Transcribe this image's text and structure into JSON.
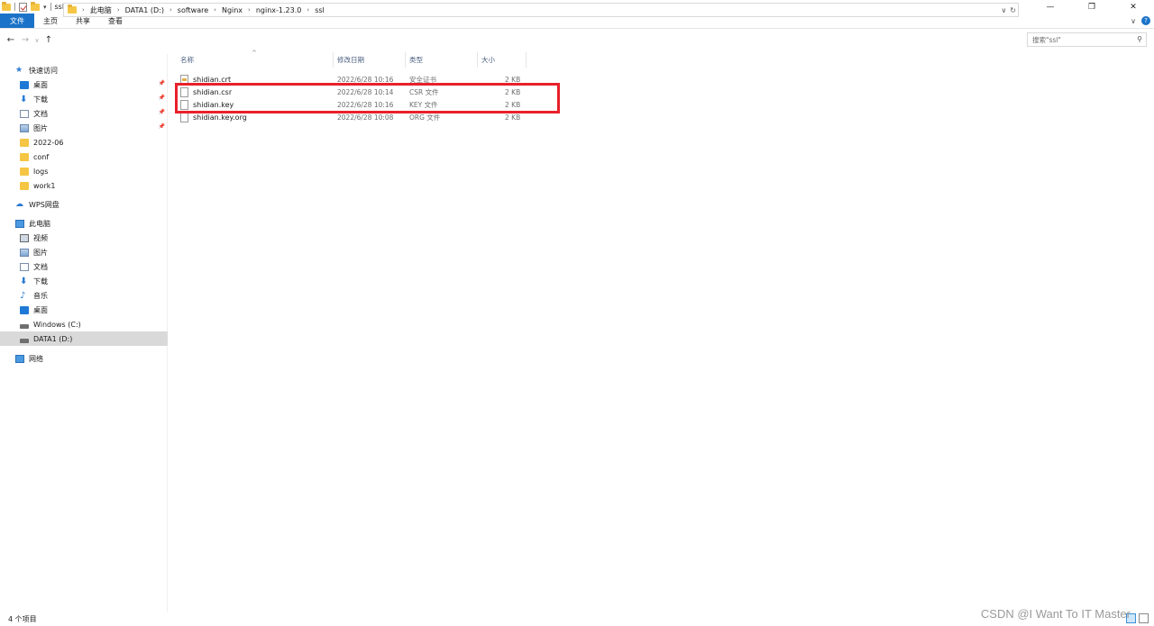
{
  "window": {
    "title": "ssl",
    "controls": [
      "—",
      "❐",
      "✕"
    ]
  },
  "ribbon": {
    "tabs": [
      "文件",
      "主页",
      "共享",
      "查看"
    ]
  },
  "address": {
    "crumbs": [
      "此电脑",
      "DATA1 (D:)",
      "software",
      "Nginx",
      "nginx-1.23.0",
      "ssl"
    ]
  },
  "search": {
    "placeholder": "搜索\"ssl\""
  },
  "sidebar": {
    "items": [
      {
        "label": "快速访问",
        "icon": "star-icon",
        "level": 0,
        "pinned": false,
        "selected": false
      },
      {
        "label": "桌面",
        "icon": "desktop-icon",
        "level": 1,
        "pinned": true,
        "selected": false
      },
      {
        "label": "下载",
        "icon": "download-icon",
        "level": 1,
        "pinned": true,
        "selected": false
      },
      {
        "label": "文档",
        "icon": "document-icon",
        "level": 1,
        "pinned": true,
        "selected": false
      },
      {
        "label": "图片",
        "icon": "picture-icon",
        "level": 1,
        "pinned": true,
        "selected": false
      },
      {
        "label": "2022-06",
        "icon": "folder-icon",
        "level": 1,
        "pinned": false,
        "selected": false
      },
      {
        "label": "conf",
        "icon": "folder-icon",
        "level": 1,
        "pinned": false,
        "selected": false
      },
      {
        "label": "logs",
        "icon": "folder-icon",
        "level": 1,
        "pinned": false,
        "selected": false
      },
      {
        "label": "work1",
        "icon": "folder-icon",
        "level": 1,
        "pinned": false,
        "selected": false
      },
      {
        "label": "WPS网盘",
        "icon": "cloud-icon",
        "level": 0,
        "pinned": false,
        "selected": false
      },
      {
        "label": "此电脑",
        "icon": "computer-icon",
        "level": 0,
        "pinned": false,
        "selected": false
      },
      {
        "label": "视频",
        "icon": "video-icon",
        "level": 1,
        "pinned": false,
        "selected": false
      },
      {
        "label": "图片",
        "icon": "picture-icon",
        "level": 1,
        "pinned": false,
        "selected": false
      },
      {
        "label": "文档",
        "icon": "document-icon",
        "level": 1,
        "pinned": false,
        "selected": false
      },
      {
        "label": "下载",
        "icon": "download-icon",
        "level": 1,
        "pinned": false,
        "selected": false
      },
      {
        "label": "音乐",
        "icon": "music-icon",
        "level": 1,
        "pinned": false,
        "selected": false
      },
      {
        "label": "桌面",
        "icon": "desktop-icon",
        "level": 1,
        "pinned": false,
        "selected": false
      },
      {
        "label": "Windows (C:)",
        "icon": "drive-icon",
        "level": 1,
        "pinned": false,
        "selected": false
      },
      {
        "label": "DATA1 (D:)",
        "icon": "drive-icon",
        "level": 1,
        "pinned": false,
        "selected": true
      },
      {
        "label": "网络",
        "icon": "network-icon",
        "level": 0,
        "pinned": false,
        "selected": false
      }
    ]
  },
  "columns": [
    "名称",
    "修改日期",
    "类型",
    "大小"
  ],
  "files": [
    {
      "name": "shidian.crt",
      "date": "2022/6/28 10:16",
      "type": "安全证书",
      "size": "2 KB",
      "icon": "certificate-file-icon"
    },
    {
      "name": "shidian.csr",
      "date": "2022/6/28 10:14",
      "type": "CSR 文件",
      "size": "2 KB",
      "icon": "file-icon"
    },
    {
      "name": "shidian.key",
      "date": "2022/6/28 10:16",
      "type": "KEY 文件",
      "size": "2 KB",
      "icon": "file-icon"
    },
    {
      "name": "shidian.key.org",
      "date": "2022/6/28 10:08",
      "type": "ORG 文件",
      "size": "2 KB",
      "icon": "file-icon"
    }
  ],
  "status": {
    "count": "4 个项目"
  },
  "watermark": "CSDN @I Want To IT Master",
  "colors": {
    "accent": "#1a73c8",
    "highlight_box": "#e8202a",
    "selected_bg": "#d9d9d9"
  }
}
